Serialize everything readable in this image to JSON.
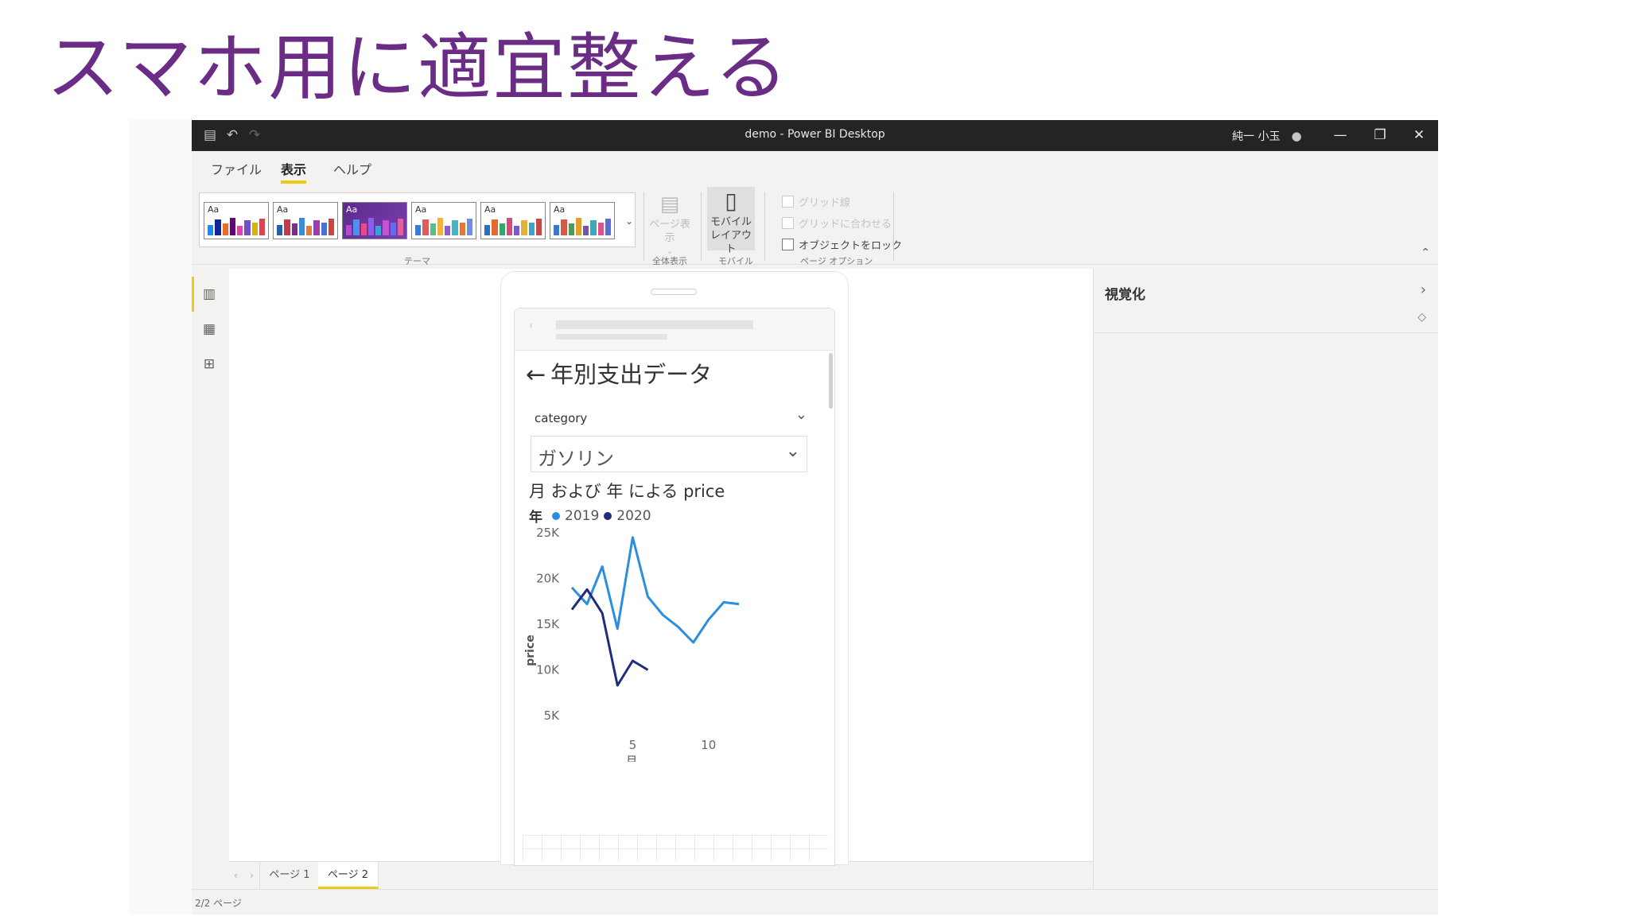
{
  "slide": {
    "title": "スマホ用に適宜整える"
  },
  "window": {
    "title": "demo - Power BI Desktop",
    "user": "純一 小玉"
  },
  "menu": {
    "items": [
      "ファイル",
      "表示",
      "ヘルプ"
    ],
    "active": "表示"
  },
  "ribbon": {
    "theme_group_label": "テーマ",
    "theme_aa": "Aa",
    "page_view_label": "ページ表示",
    "full_view_group_label": "全体表示",
    "mobile_layout_label_1": "モバイル",
    "mobile_layout_label_2": "レイアウト",
    "mobile_group_label": "モバイル",
    "options": [
      {
        "label": "グリッド線",
        "checked": false,
        "disabled": true
      },
      {
        "label": "グリッドに合わせる",
        "checked": false,
        "disabled": true
      },
      {
        "label": "オブジェクトをロック",
        "checked": false,
        "disabled": false
      }
    ],
    "page_options_group_label": "ページ オプション"
  },
  "right_pane": {
    "title": "視覚化"
  },
  "report": {
    "title": "年別支出データ",
    "slicer": {
      "label": "category",
      "value": "ガソリン"
    },
    "chart_title": "月 および 年 による price",
    "legend_title": "年"
  },
  "chart_data": {
    "type": "line",
    "title": "月 および 年 による price",
    "xlabel": "月",
    "ylabel": "price",
    "x_ticks": [
      "5",
      "10"
    ],
    "y_ticks": [
      "25K",
      "20K",
      "15K",
      "10K",
      "5K"
    ],
    "xlim": [
      1,
      12
    ],
    "ylim": [
      4500,
      25500
    ],
    "legend_title": "年",
    "series": [
      {
        "name": "2019",
        "color": "#2b8ee0",
        "points": [
          [
            1,
            19000
          ],
          [
            2,
            17200
          ],
          [
            3,
            21300
          ],
          [
            4,
            14500
          ],
          [
            5,
            24500
          ],
          [
            6,
            18000
          ],
          [
            7,
            16000
          ],
          [
            8,
            14700
          ],
          [
            9,
            13000
          ],
          [
            10,
            15500
          ],
          [
            11,
            17400
          ],
          [
            12,
            17200
          ]
        ]
      },
      {
        "name": "2020",
        "color": "#1f2d7a",
        "points": [
          [
            1,
            16600
          ],
          [
            2,
            18800
          ],
          [
            3,
            16200
          ],
          [
            4,
            8300
          ],
          [
            5,
            11000
          ],
          [
            6,
            10000
          ]
        ]
      }
    ]
  },
  "pages": {
    "tabs": [
      "ページ 1",
      "ページ 2"
    ],
    "active_index": 1
  },
  "status": {
    "text": "2/2 ページ"
  },
  "theme_palettes": [
    [
      "#118dff",
      "#12239e",
      "#e66c37",
      "#6b007b",
      "#e044a7",
      "#744ec2",
      "#d9b300",
      "#d64550"
    ],
    [
      "#2a5fa8",
      "#c03b4c",
      "#7a2f8e",
      "#3d8ad9",
      "#e37b3b",
      "#9b3cb0",
      "#4c6fd1",
      "#d34242"
    ],
    [
      "#b54ad1",
      "#4f8ff0",
      "#e84a8a",
      "#8a5cf0",
      "#3fa0d8",
      "#c94fd6",
      "#5a6ef2",
      "#e05fa0"
    ],
    [
      "#3a7bd5",
      "#e05c5c",
      "#5bbf8a",
      "#f0b341",
      "#8f5cd9",
      "#4ab3c9",
      "#e07a3c",
      "#6c8ee8"
    ],
    [
      "#2f6fbd",
      "#e46b2b",
      "#38a36b",
      "#d94a7a",
      "#7c5cc4",
      "#e0b43c",
      "#3aa5c9",
      "#c44a4a"
    ],
    [
      "#3a78c9",
      "#d45a46",
      "#4a9e5c",
      "#e0a030",
      "#7a52b5",
      "#3fa7b5",
      "#d9548a",
      "#5a6fd6"
    ]
  ]
}
